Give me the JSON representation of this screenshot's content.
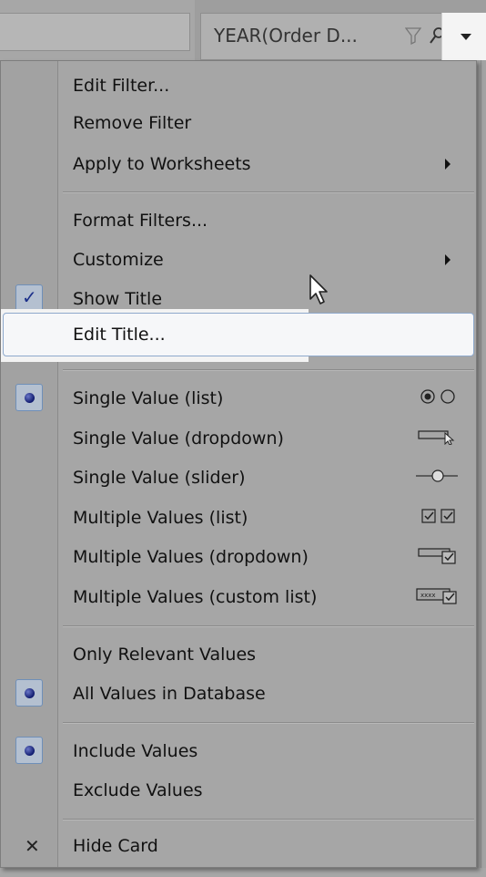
{
  "header": {
    "filter_title": "YEAR(Order D...",
    "icons": [
      "filter-funnel-icon",
      "search-icon",
      "dropdown-arrow-icon"
    ]
  },
  "menu": {
    "items": [
      {
        "label": "Edit Filter..."
      },
      {
        "label": "Remove Filter"
      },
      {
        "label": "Apply to Worksheets",
        "submenu": true
      },
      {
        "label": "Format Filters..."
      },
      {
        "label": "Customize",
        "submenu": true
      },
      {
        "label": "Show Title",
        "checked": true
      },
      {
        "label": "Edit Title...",
        "highlighted": true
      },
      {
        "label": "Single Value (list)",
        "selected": true,
        "icon": "radio-pair-icon"
      },
      {
        "label": "Single Value (dropdown)",
        "icon": "dropdown-pointer-icon"
      },
      {
        "label": "Single Value (slider)",
        "icon": "slider-icon"
      },
      {
        "label": "Multiple Values (list)",
        "icon": "checkbox-pair-icon"
      },
      {
        "label": "Multiple Values (dropdown)",
        "icon": "dropdown-checkbox-icon"
      },
      {
        "label": "Multiple Values (custom list)",
        "icon": "custom-list-icon"
      },
      {
        "label": "Only Relevant Values"
      },
      {
        "label": "All Values in Database",
        "selected": true
      },
      {
        "label": "Include Values",
        "selected": true
      },
      {
        "label": "Exclude Values"
      },
      {
        "label": "Hide Card",
        "icon": "close-icon"
      }
    ],
    "custom_list_icon_text": "xxxx"
  },
  "colors": {
    "menu_background": "#a6a6a6",
    "highlight_background": "#f6f7f9",
    "highlight_border": "#8ea9cc",
    "selection_box": "#b4c0d0",
    "selection_dot": "#0f1a6e"
  }
}
